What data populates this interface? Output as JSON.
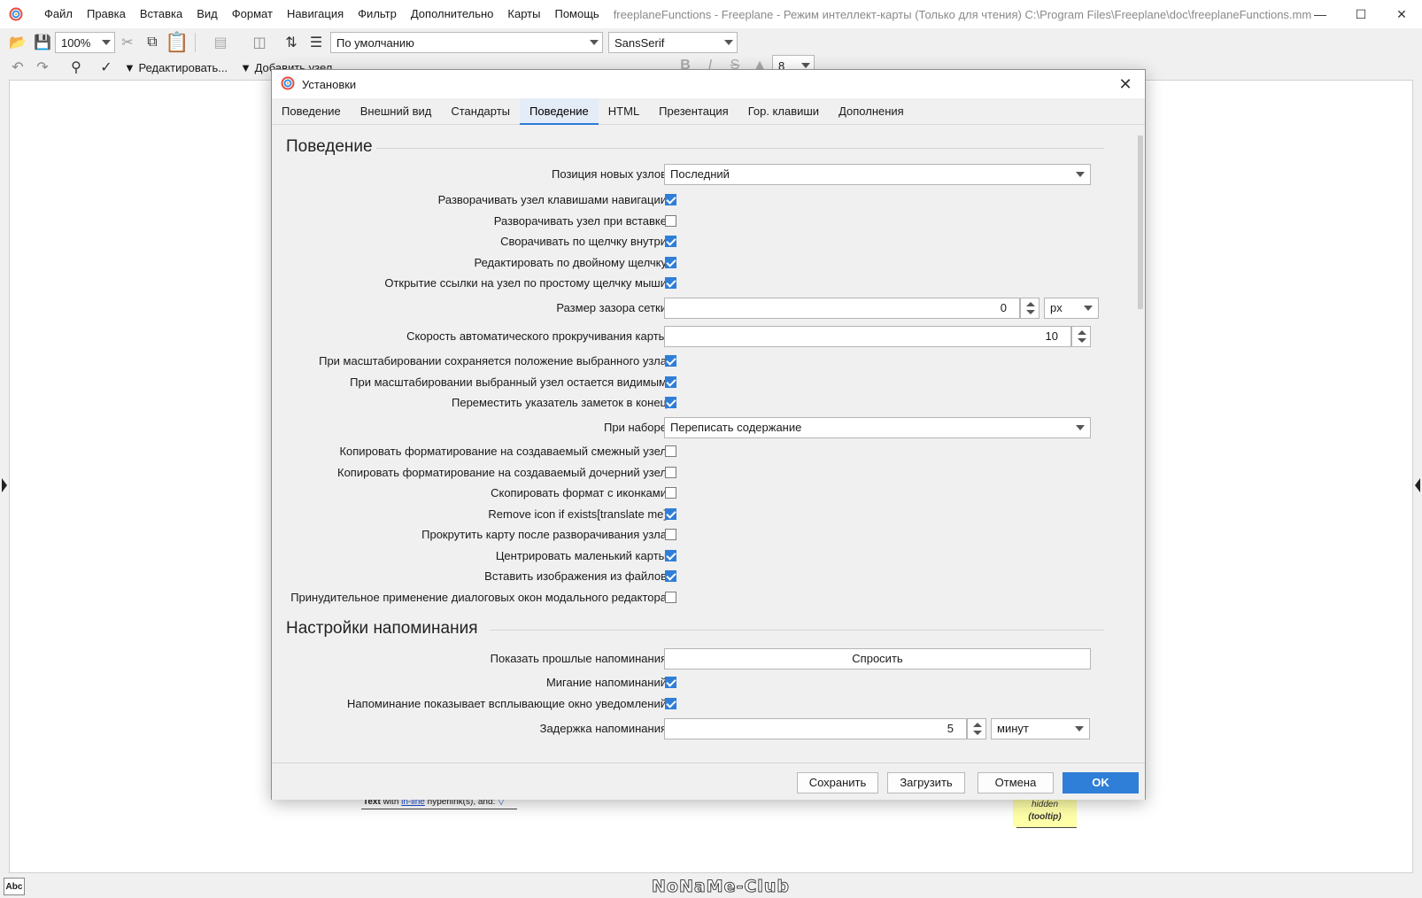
{
  "window": {
    "title": "freeplaneFunctions - Freeplane - Режим интеллект-карты (Только для чтения) C:\\Program Files\\Freeplane\\doc\\freeplaneFunctions.mm",
    "menu": [
      "Файл",
      "Правка",
      "Вставка",
      "Вид",
      "Формат",
      "Навигация",
      "Фильтр",
      "Дополнительно",
      "Карты",
      "Помощь"
    ]
  },
  "toolbar": {
    "zoom": "100%",
    "style": "По умолчанию",
    "font": "SansSerif",
    "font_size": "8",
    "edit_label": "▼ Редактировать...",
    "add_label": "▼ Добавить узел"
  },
  "dialog": {
    "title": "Установки",
    "close_icon": "close-icon",
    "tabs": [
      "Поведение",
      "Внешний вид",
      "Стандарты",
      "Поведение",
      "HTML",
      "Презентация",
      "Гор. клавиши",
      "Дополнения"
    ],
    "active_tab": 3,
    "section_behavior": "Поведение",
    "new_node_position_label": "Позиция новых узлов",
    "new_node_position_value": "Последний",
    "checks1": [
      {
        "label": "Разворачивать узел клавишами навигации",
        "checked": true
      },
      {
        "label": "Разворачивать узел при вставке",
        "checked": false
      },
      {
        "label": "Сворачивать по щелчку внутри",
        "checked": true
      },
      {
        "label": "Редактировать по двойному щелчку",
        "checked": true
      },
      {
        "label": "Открытие ссылки на узел по простому щелчку мыши",
        "checked": true
      }
    ],
    "grid_gap_label": "Размер зазора сетки",
    "grid_gap_value": "0",
    "grid_gap_unit": "px",
    "scroll_speed_label": "Скорость автоматического прокручивания карты",
    "scroll_speed_value": "10",
    "checks2": [
      {
        "label": "При масштабировании сохраняется положение выбранного узла",
        "checked": true
      },
      {
        "label": "При масштабировании выбранный узел остается видимым",
        "checked": true
      },
      {
        "label": "Переместить указатель заметок в конец",
        "checked": true
      }
    ],
    "typing_label": "При наборе",
    "typing_value": "Переписать содержание",
    "checks3": [
      {
        "label": "Копировать форматирование на создаваемый смежный узел",
        "checked": false
      },
      {
        "label": "Копировать форматирование на создаваемый дочерний узел",
        "checked": false
      },
      {
        "label": "Скопировать формат с иконками",
        "checked": false
      },
      {
        "label": "Remove icon if exists[translate me]",
        "checked": true
      },
      {
        "label": "Прокрутить карту после разворачивания узла",
        "checked": false
      },
      {
        "label": "Центрировать маленький карты",
        "checked": true
      },
      {
        "label": "Вставить изображения из файлов",
        "checked": true
      },
      {
        "label": "Принудительное применение диалоговых окон модального редактора",
        "checked": false
      }
    ],
    "section_reminders": "Настройки напоминания",
    "past_reminders_label": "Показать прошлые напоминания",
    "past_reminders_value": "Спросить",
    "checks4": [
      {
        "label": "Мигание напоминаний",
        "checked": true
      },
      {
        "label": "Напоминание показывает всплывающие окно уведомлений",
        "checked": true
      }
    ],
    "reminder_delay_label": "Задержка напоминания",
    "reminder_delay_value": "5",
    "reminder_delay_unit": "минут",
    "buttons": {
      "save": "Сохранить",
      "load": "Загрузить",
      "cancel": "Отмена",
      "ok": "OK"
    }
  },
  "canvas": {
    "node_text_bold": "Text",
    "node_text_with": " with ",
    "node_text_link": "in-line",
    "node_text_rest": " hyperlink(s), and: ",
    "sticky_line1": "hidden",
    "sticky_line2": "(tooltip)"
  },
  "status": {
    "abc": "Abc",
    "watermark": "NoNaMe-Club"
  },
  "colors": {
    "accent": "#2f7ed8",
    "sticky": "#ffffa8"
  }
}
